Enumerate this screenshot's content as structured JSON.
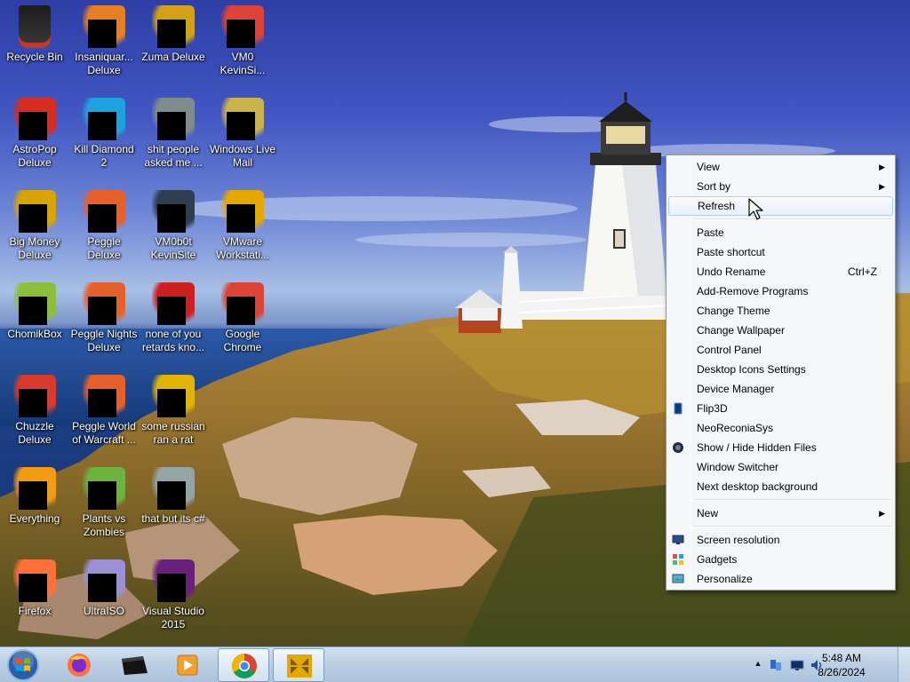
{
  "desktop": {
    "icons": [
      {
        "label": "Recycle Bin",
        "icon": "recycle-bin-icon",
        "color": "#c0392b"
      },
      {
        "label": "Insaniquar...\nDeluxe",
        "icon": "insaniquarium-icon",
        "color": "#e67e22"
      },
      {
        "label": "Zuma Deluxe",
        "icon": "zuma-icon",
        "color": "#d4a017"
      },
      {
        "label": "VM0\nKevinSi...",
        "icon": "chrome-shortcut-icon",
        "color": "#db4437"
      },
      {
        "label": "AstroPop\nDeluxe",
        "icon": "astropop-icon",
        "color": "#d62d20"
      },
      {
        "label": "Kill Diamond\n2",
        "icon": "diamond-icon",
        "color": "#1fa3e0"
      },
      {
        "label": "shit people\nasked me ...",
        "icon": "folder-icon",
        "color": "#7f8c8d"
      },
      {
        "label": "Windows Live\nMail",
        "icon": "mail-icon",
        "color": "#c9b34a"
      },
      {
        "label": "Big Money\nDeluxe",
        "icon": "money-bag-icon",
        "color": "#d9a400"
      },
      {
        "label": "Peggle Deluxe",
        "icon": "peggle-icon",
        "color": "#e6612a"
      },
      {
        "label": "VM0b0t\nKevinSite",
        "icon": "vm-icon",
        "color": "#2c3e50"
      },
      {
        "label": "VMware\nWorkstati...",
        "icon": "vmware-icon",
        "color": "#e5a800"
      },
      {
        "label": "ChomikBox",
        "icon": "hamster-icon",
        "color": "#8bbf3a"
      },
      {
        "label": "Peggle Nights\nDeluxe",
        "icon": "peggle-nights-icon",
        "color": "#e6612a"
      },
      {
        "label": "none of you\nretards kno...",
        "icon": "opera-icon",
        "color": "#cc1f1f"
      },
      {
        "label": "Google\nChrome",
        "icon": "chrome-icon",
        "color": "#db4437"
      },
      {
        "label": "Chuzzle\nDeluxe",
        "icon": "chuzzle-icon",
        "color": "#d93a2b"
      },
      {
        "label": "Peggle World\nof Warcraft ...",
        "icon": "peggle-wow-icon",
        "color": "#e6612a"
      },
      {
        "label": "some russian\nran a rat",
        "icon": "document-icon",
        "color": "#e0b400"
      },
      {
        "label": "",
        "icon": "blank-icon",
        "color": ""
      },
      {
        "label": "Everything",
        "icon": "everything-icon",
        "color": "#f39c12"
      },
      {
        "label": "Plants vs\nZombies",
        "icon": "pvz-icon",
        "color": "#6db33f"
      },
      {
        "label": "that but its c#",
        "icon": "files-icon",
        "color": "#95a5a6"
      },
      {
        "label": "",
        "icon": "blank-icon",
        "color": ""
      },
      {
        "label": "Firefox",
        "icon": "firefox-icon",
        "color": "#ff7139"
      },
      {
        "label": "UltraISO",
        "icon": "disc-icon",
        "color": "#9b8fd6"
      },
      {
        "label": "Visual Studio\n2015",
        "icon": "visual-studio-icon",
        "color": "#68217a"
      }
    ]
  },
  "context_menu": {
    "items": [
      {
        "type": "item",
        "label": "View",
        "submenu": true
      },
      {
        "type": "item",
        "label": "Sort by",
        "submenu": true
      },
      {
        "type": "item",
        "label": "Refresh",
        "hover": true
      },
      {
        "type": "sep"
      },
      {
        "type": "item",
        "label": "Paste"
      },
      {
        "type": "item",
        "label": "Paste shortcut"
      },
      {
        "type": "item",
        "label": "Undo Rename",
        "shortcut": "Ctrl+Z"
      },
      {
        "type": "item",
        "label": "Add-Remove Programs"
      },
      {
        "type": "item",
        "label": "Change Theme"
      },
      {
        "type": "item",
        "label": "Change Wallpaper"
      },
      {
        "type": "item",
        "label": "Control Panel"
      },
      {
        "type": "item",
        "label": "Desktop Icons Settings"
      },
      {
        "type": "item",
        "label": "Device Manager"
      },
      {
        "type": "item",
        "label": "Flip3D",
        "icon": "flip3d-icon"
      },
      {
        "type": "item",
        "label": "NeoReconiaSys"
      },
      {
        "type": "item",
        "label": "Show / Hide Hidden Files",
        "icon": "hidden-files-icon"
      },
      {
        "type": "item",
        "label": "Window Switcher"
      },
      {
        "type": "item",
        "label": "Next desktop background"
      },
      {
        "type": "sep"
      },
      {
        "type": "item",
        "label": "New",
        "submenu": true
      },
      {
        "type": "sep"
      },
      {
        "type": "item",
        "label": "Screen resolution",
        "icon": "monitor-icon"
      },
      {
        "type": "item",
        "label": "Gadgets",
        "icon": "gadgets-icon"
      },
      {
        "type": "item",
        "label": "Personalize",
        "icon": "personalize-icon"
      }
    ]
  },
  "taskbar": {
    "pinned": [
      {
        "name": "firefox",
        "icon": "firefox-icon"
      },
      {
        "name": "app-dark",
        "icon": "black-box-icon"
      },
      {
        "name": "media",
        "icon": "media-player-icon"
      },
      {
        "name": "chrome",
        "icon": "chrome-icon",
        "active": true
      },
      {
        "name": "vmware",
        "icon": "vmware-icon",
        "active": true
      }
    ],
    "clock": {
      "time": "5:48 AM",
      "date": "8/26/2024"
    }
  }
}
